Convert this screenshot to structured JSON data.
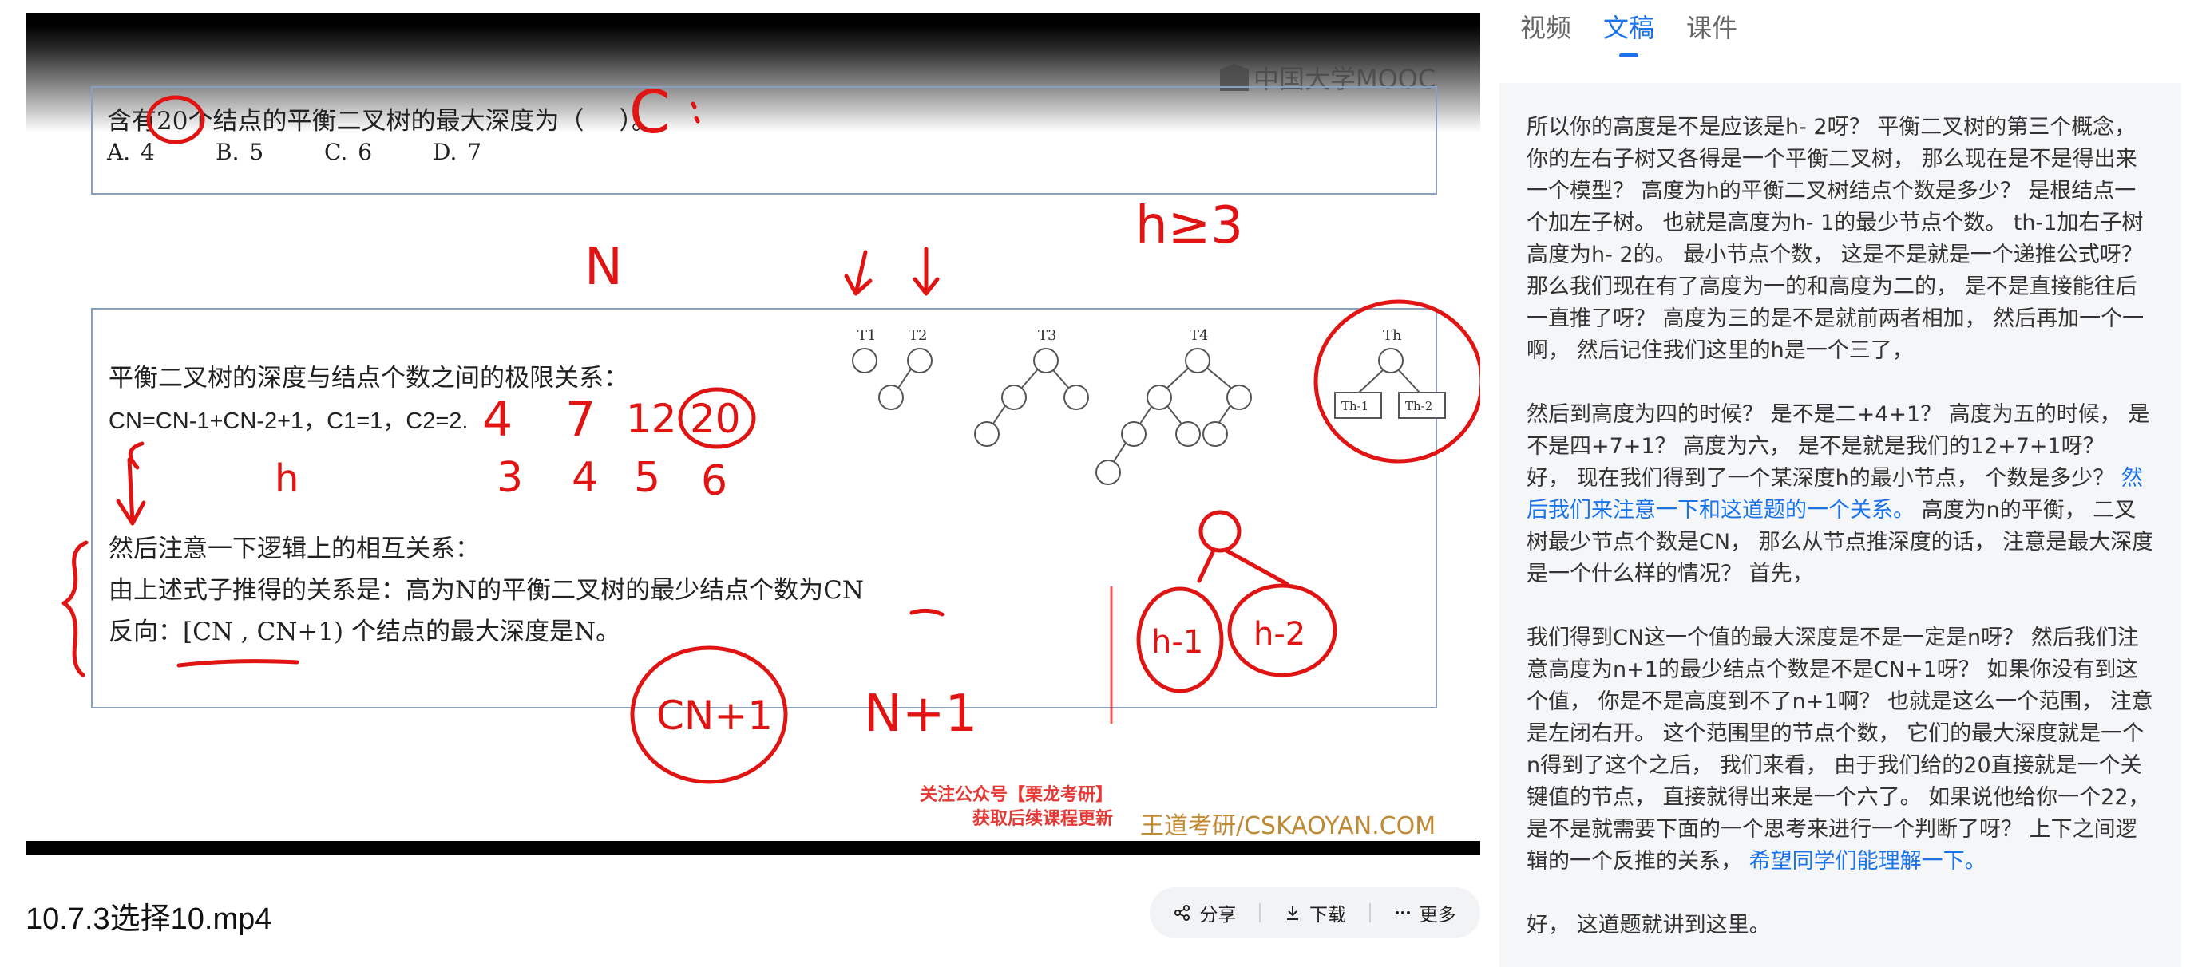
{
  "video": {
    "watermark": "中国大学MOOC",
    "question": {
      "stem_before": "含有",
      "stem_number": "20",
      "stem_after": "个结点的平衡二叉树的最大深度为（",
      "stem_close": "）。",
      "options": [
        "A. 4",
        "B. 5",
        "C. 6",
        "D. 7"
      ]
    },
    "slide": {
      "heading": "平衡二叉树的深度与结点个数之间的极限关系：",
      "formula": "CN=CN-1+CN-2+1，C1=1，C2=2.",
      "note1": "然后注意一下逻辑上的相互关系：",
      "note2": "由上述式子推得的关系是：高为N的平衡二叉树的最少结点个数为CN",
      "note3": "反向：[CN , CN+1) 个结点的最大深度是N。"
    },
    "trees": [
      "T1",
      "T2",
      "T3",
      "T4",
      "Th",
      "Th-1",
      "Th-2"
    ],
    "handwriting": {
      "answer": "C",
      "h_ge": "h≥3",
      "n": "N",
      "counts": [
        "4",
        "7",
        "12",
        "20"
      ],
      "heights": [
        "3",
        "4",
        "5",
        "6"
      ],
      "h": "h",
      "cn1": "CN+1",
      "n1": "N+1",
      "hm1": "h-1",
      "hm2": "h-2"
    },
    "promo_line1": "关注公众号【栗龙考研】",
    "promo_line2": "获取后续课程更新",
    "brand": "王道考研/CSKAOYAN.COM"
  },
  "file_title": "10.7.3选择10.mp4",
  "actions": {
    "share": "分享",
    "download": "下载",
    "more": "更多"
  },
  "tabs": [
    "视频",
    "文稿",
    "课件"
  ],
  "active_tab": "文稿",
  "transcript": {
    "p1": "所以你的高度是不是应该是h- 2呀？ 平衡二叉树的第三个概念， 你的左右子树又各得是一个平衡二叉树， 那么现在是不是得出来一个模型？ 高度为h的平衡二叉树结点个数是多少？ 是根结点一个加左子树。 也就是高度为h- 1的最少节点个数。 th-1加右子树高度为h- 2的。 最小节点个数， 这是不是就是一个递推公式呀？ 那么我们现在有了高度为一的和高度为二的， 是不是直接能往后一直推了呀？ 高度为三的是不是就前两者相加， 然后再加一个一啊， 然后记住我们这里的h是一个三了，",
    "p2a": "然后到高度为四的时候？ 是不是二+4+1？ 高度为五的时候， 是不是四+7+1？ 高度为六， 是不是就是我们的12+7+1呀？ 好， 现在我们得到了一个某深度h的最小节点， 个数是多少？ ",
    "p2hl": "然后我们来注意一下和这道题的一个关系。",
    "p2b": " 高度为n的平衡， 二叉树最少节点个数是CN， 那么从节点推深度的话， 注意是最大深度是一个什么样的情况？ 首先，",
    "p3a": "我们得到CN这一个值的最大深度是不是一定是n呀？ 然后我们注意高度为n+1的最少结点个数是不是CN+1呀？ 如果你没有到这个值， 你是不是高度到不了n+1啊？ 也就是这么一个范围， 注意是左闭右开。 这个范围里的节点个数， 它们的最大深度就是一个n得到了这个之后， 我们来看， 由于我们给的20直接就是一个关键值的节点， 直接就得出来是一个六了。 如果说他给你一个22， 是不是就需要下面的一个思考来进行一个判断了呀？ 上下之间逻辑的一个反推的关系， ",
    "p3hl": "希望同学们能理解一下。",
    "p4": "好， 这道题就讲到这里。"
  }
}
